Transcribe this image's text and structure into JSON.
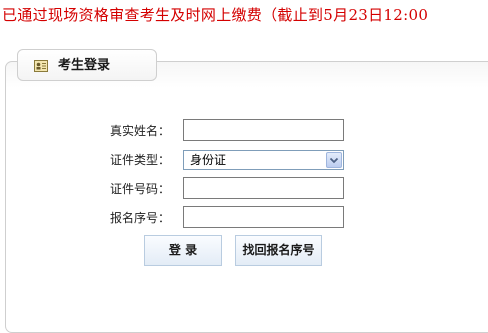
{
  "notice": {
    "text": "已通过现场资格审查考生及时网上缴费（截止到5月23日12:00"
  },
  "panel": {
    "title": "考生登录",
    "icon": "id-card-icon"
  },
  "form": {
    "name_label": "真实姓名：",
    "name_value": "",
    "id_type_label": "证件类型：",
    "id_type_selected": "身份证",
    "id_number_label": "证件号码：",
    "id_number_value": "",
    "reg_number_label": "报名序号：",
    "reg_number_value": ""
  },
  "buttons": {
    "login": "登 录",
    "recover": "找回报名序号"
  },
  "colors": {
    "notice_text": "#d40000",
    "select_border": "#7f9db9",
    "button_border": "#b9cce0"
  }
}
